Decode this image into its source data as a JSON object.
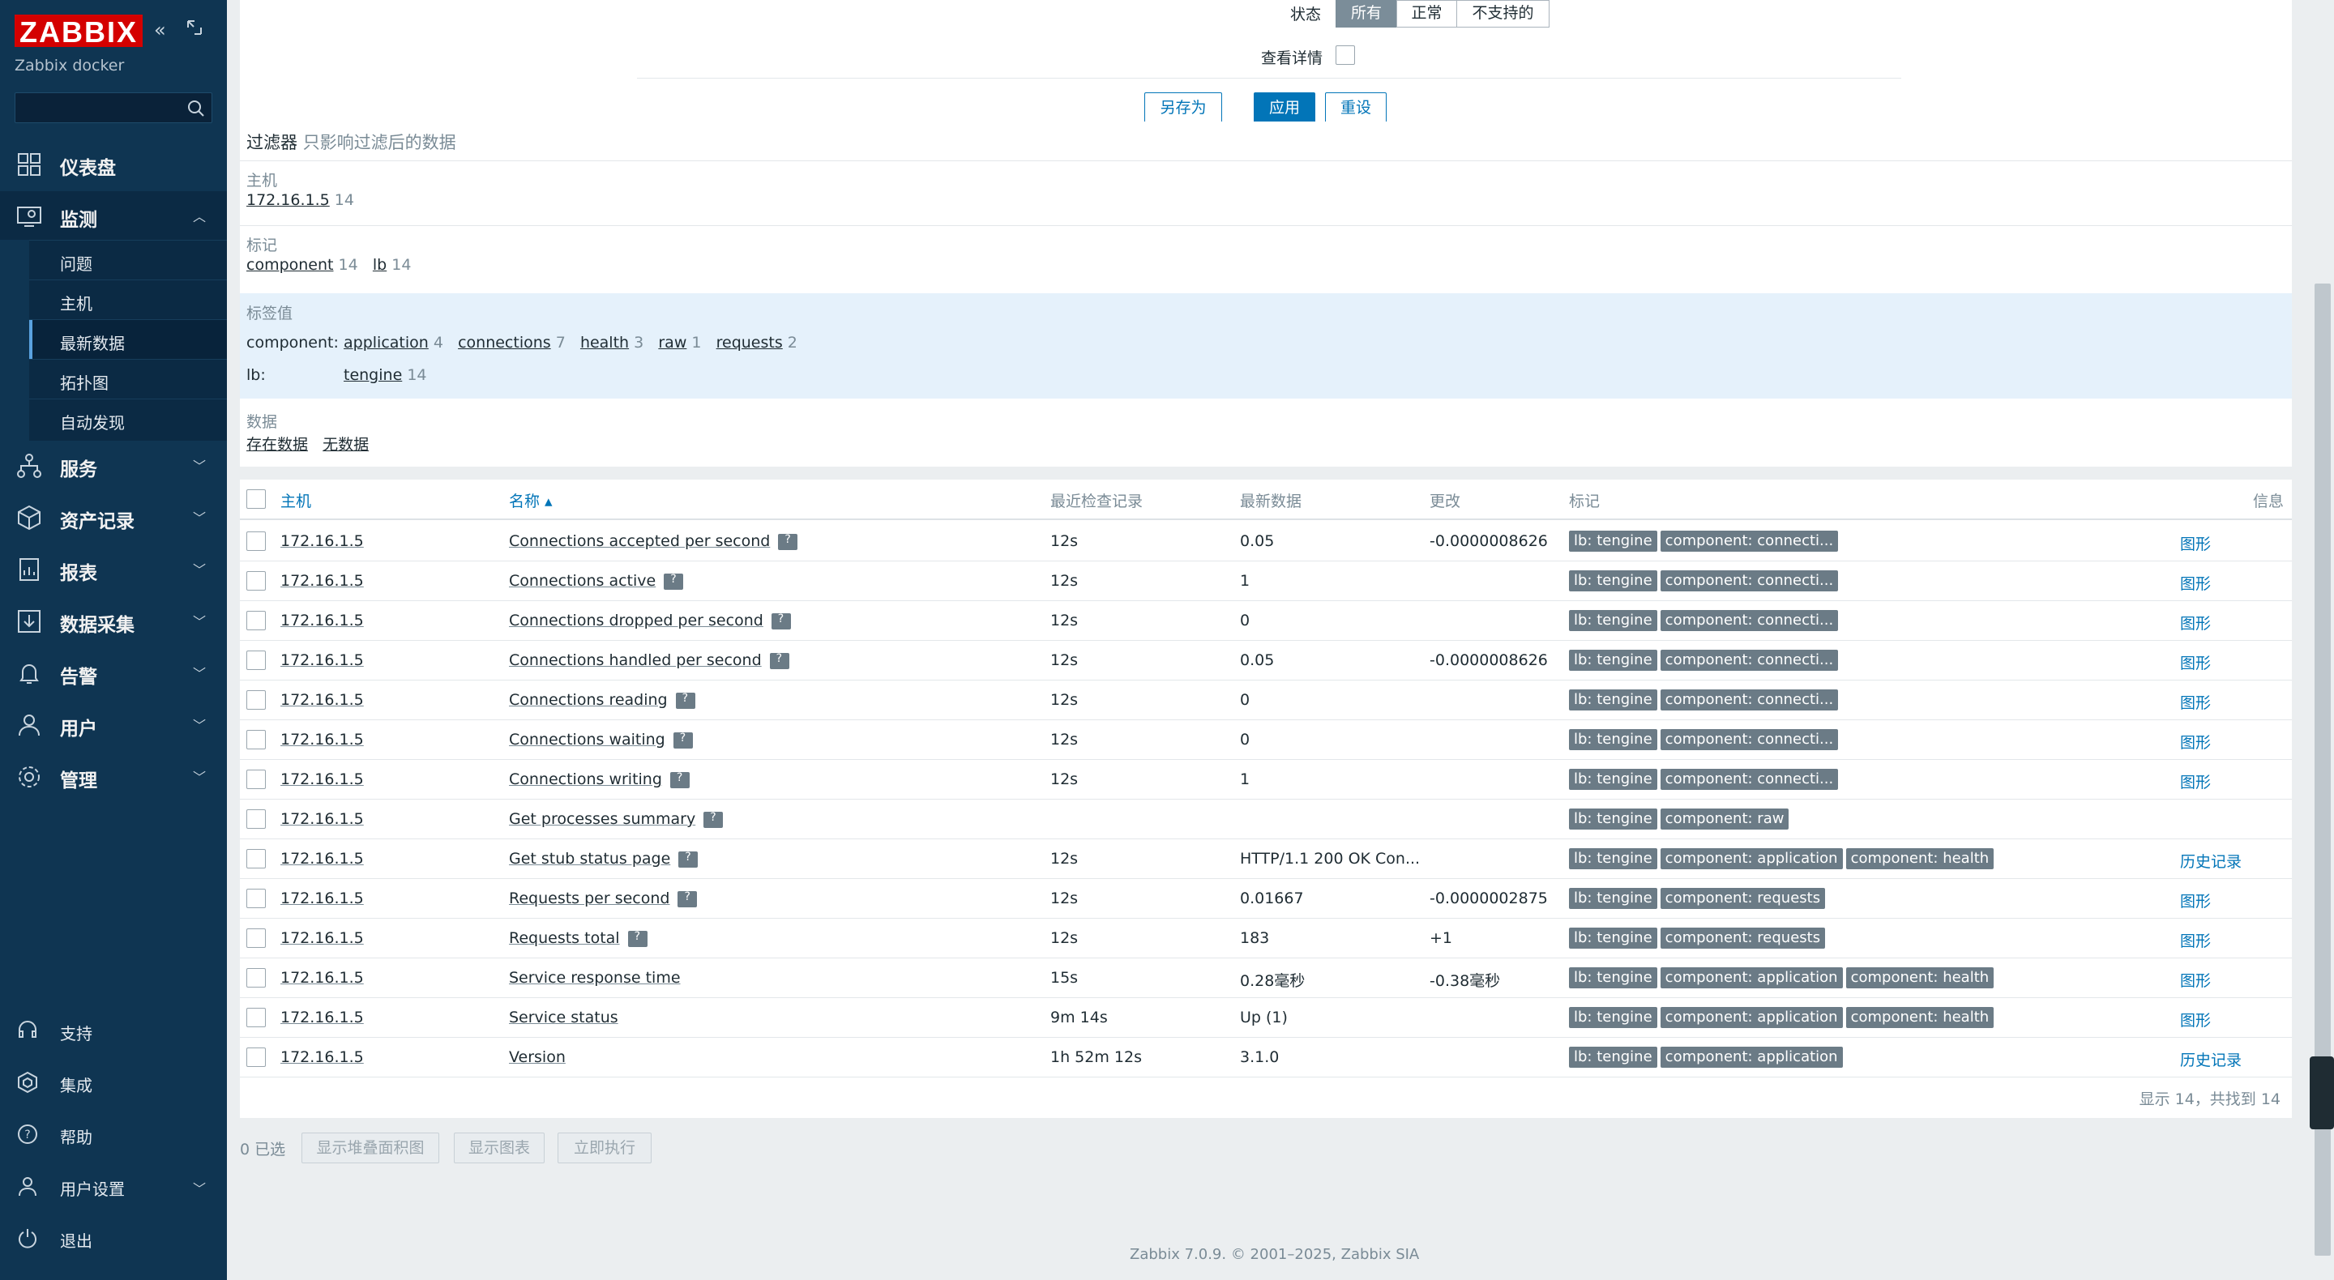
{
  "sidebar": {
    "logo": "ZABBIX",
    "subtitle": "Zabbix docker",
    "search_placeholder": "",
    "nav": [
      {
        "label": "仪表盘",
        "icon": "dashboard-icon"
      },
      {
        "label": "监测",
        "icon": "monitoring-icon",
        "expanded": true
      },
      {
        "label": "服务",
        "icon": "services-icon"
      },
      {
        "label": "资产记录",
        "icon": "inventory-icon"
      },
      {
        "label": "报表",
        "icon": "reports-icon"
      },
      {
        "label": "数据采集",
        "icon": "data-collection-icon"
      },
      {
        "label": "告警",
        "icon": "alerts-icon"
      },
      {
        "label": "用户",
        "icon": "users-icon"
      },
      {
        "label": "管理",
        "icon": "administration-icon"
      }
    ],
    "monitoring_sub": [
      {
        "label": "问题"
      },
      {
        "label": "主机"
      },
      {
        "label": "最新数据",
        "active": true
      },
      {
        "label": "拓扑图"
      },
      {
        "label": "自动发现"
      }
    ],
    "footer": [
      {
        "label": "支持",
        "icon": "support-icon"
      },
      {
        "label": "集成",
        "icon": "integrations-icon"
      },
      {
        "label": "帮助",
        "icon": "help-icon"
      },
      {
        "label": "用户设置",
        "icon": "user-settings-icon"
      },
      {
        "label": "退出",
        "icon": "sign-out-icon"
      }
    ]
  },
  "filter_form": {
    "state_label": "状态",
    "state_options": [
      "所有",
      "正常",
      "不支持的"
    ],
    "state_selected": "所有",
    "details_label": "查看详情",
    "save_as": "另存为",
    "apply": "应用",
    "reset": "重设"
  },
  "subfilter": {
    "title": "过滤器",
    "note": "只影响过滤后的数据",
    "host_label": "主机",
    "host_value": "172.16.1.5",
    "host_count": "14",
    "tags_label": "标记",
    "tags": [
      {
        "name": "component",
        "count": "14"
      },
      {
        "name": "lb",
        "count": "14"
      }
    ],
    "tagvals_label": "标签值",
    "component_label": "component:",
    "component_values": [
      {
        "name": "application",
        "count": "4"
      },
      {
        "name": "connections",
        "count": "7"
      },
      {
        "name": "health",
        "count": "3"
      },
      {
        "name": "raw",
        "count": "1"
      },
      {
        "name": "requests",
        "count": "2"
      }
    ],
    "lb_label": "lb:",
    "lb_values": [
      {
        "name": "tengine",
        "count": "14"
      }
    ],
    "data_label": "数据",
    "data_with": "存在数据",
    "data_without": "无数据"
  },
  "table": {
    "headers": {
      "host": "主机",
      "name": "名称 ▴",
      "last_check": "最近检查记录",
      "last_value": "最新数据",
      "change": "更改",
      "tags": "标记",
      "info": "信息"
    },
    "rows": [
      {
        "host": "172.16.1.5",
        "name": "Connections accepted per second",
        "hint": true,
        "last_check": "12s",
        "last_value": "0.05",
        "change": "-0.0000008626",
        "tags": [
          "lb: tengine",
          "component: connecti..."
        ],
        "action": "图形"
      },
      {
        "host": "172.16.1.5",
        "name": "Connections active",
        "hint": true,
        "last_check": "12s",
        "last_value": "1",
        "change": "",
        "tags": [
          "lb: tengine",
          "component: connecti..."
        ],
        "action": "图形"
      },
      {
        "host": "172.16.1.5",
        "name": "Connections dropped per second",
        "hint": true,
        "last_check": "12s",
        "last_value": "0",
        "change": "",
        "tags": [
          "lb: tengine",
          "component: connecti..."
        ],
        "action": "图形"
      },
      {
        "host": "172.16.1.5",
        "name": "Connections handled per second",
        "hint": true,
        "last_check": "12s",
        "last_value": "0.05",
        "change": "-0.0000008626",
        "tags": [
          "lb: tengine",
          "component: connecti..."
        ],
        "action": "图形"
      },
      {
        "host": "172.16.1.5",
        "name": "Connections reading",
        "hint": true,
        "last_check": "12s",
        "last_value": "0",
        "change": "",
        "tags": [
          "lb: tengine",
          "component: connecti..."
        ],
        "action": "图形"
      },
      {
        "host": "172.16.1.5",
        "name": "Connections waiting",
        "hint": true,
        "last_check": "12s",
        "last_value": "0",
        "change": "",
        "tags": [
          "lb: tengine",
          "component: connecti..."
        ],
        "action": "图形"
      },
      {
        "host": "172.16.1.5",
        "name": "Connections writing",
        "hint": true,
        "last_check": "12s",
        "last_value": "1",
        "change": "",
        "tags": [
          "lb: tengine",
          "component: connecti..."
        ],
        "action": "图形"
      },
      {
        "host": "172.16.1.5",
        "name": "Get processes summary",
        "hint": true,
        "last_check": "",
        "last_value": "",
        "change": "",
        "tags": [
          "lb: tengine",
          "component: raw"
        ],
        "action": ""
      },
      {
        "host": "172.16.1.5",
        "name": "Get stub status page",
        "hint": true,
        "last_check": "12s",
        "last_value": "HTTP/1.1 200 OK Con...",
        "change": "",
        "tags": [
          "lb: tengine",
          "component: application",
          "component: health"
        ],
        "action": "历史记录"
      },
      {
        "host": "172.16.1.5",
        "name": "Requests per second",
        "hint": true,
        "last_check": "12s",
        "last_value": "0.01667",
        "change": "-0.0000002875",
        "tags": [
          "lb: tengine",
          "component: requests"
        ],
        "action": "图形"
      },
      {
        "host": "172.16.1.5",
        "name": "Requests total",
        "hint": true,
        "last_check": "12s",
        "last_value": "183",
        "change": "+1",
        "tags": [
          "lb: tengine",
          "component: requests"
        ],
        "action": "图形"
      },
      {
        "host": "172.16.1.5",
        "name": "Service response time",
        "hint": false,
        "last_check": "15s",
        "last_value": "0.28毫秒",
        "change": "-0.38毫秒",
        "tags": [
          "lb: tengine",
          "component: application",
          "component: health"
        ],
        "action": "图形"
      },
      {
        "host": "172.16.1.5",
        "name": "Service status",
        "hint": false,
        "last_check": "9m 14s",
        "last_value": "Up (1)",
        "change": "",
        "tags": [
          "lb: tengine",
          "component: application",
          "component: health"
        ],
        "action": "图形"
      },
      {
        "host": "172.16.1.5",
        "name": "Version",
        "hint": false,
        "last_check": "1h 52m 12s",
        "last_value": "3.1.0",
        "change": "",
        "tags": [
          "lb: tengine",
          "component: application"
        ],
        "action": "历史记录"
      }
    ],
    "summary": "显示 14，共找到 14"
  },
  "bottom": {
    "selected": "0 已选",
    "btn_stacked": "显示堆叠面积图",
    "btn_graph": "显示图表",
    "btn_execute": "立即执行"
  },
  "footer": "Zabbix 7.0.9. © 2001–2025, Zabbix SIA",
  "colors": {
    "sidebar": "#0f3552",
    "accent": "#0275b8",
    "logo": "#d40000",
    "tag": "#6b7b86"
  }
}
